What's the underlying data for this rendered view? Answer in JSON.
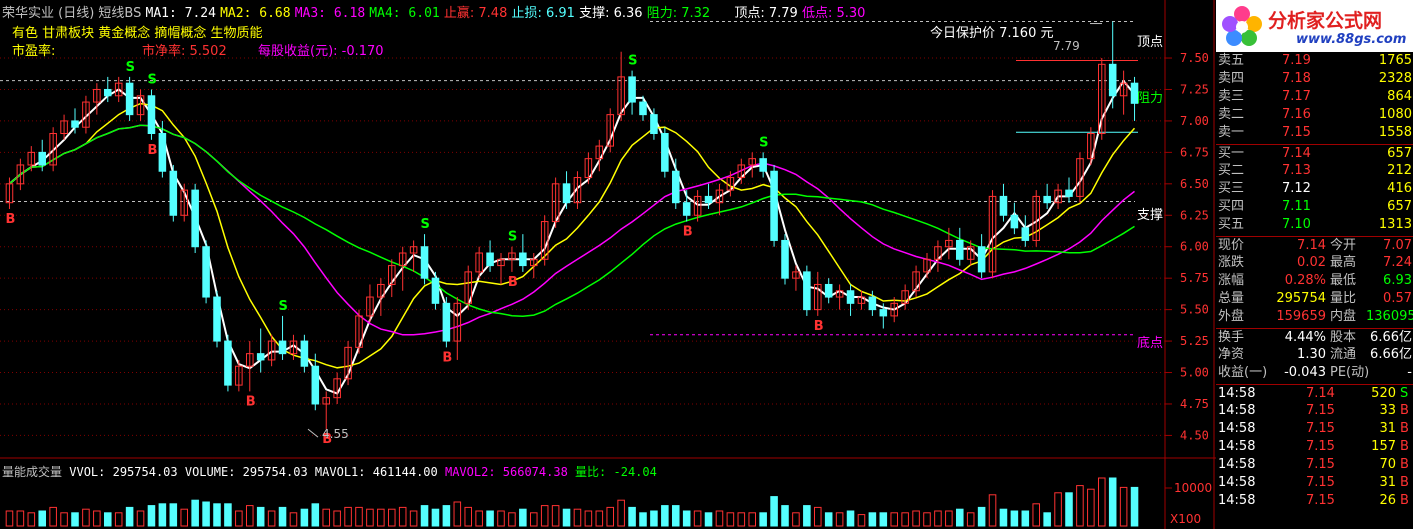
{
  "header": {
    "stock": "荣华实业 (日线)",
    "indicator": "短线BS",
    "ma1": "MA1: 7.24",
    "ma2": "MA2: 6.68",
    "ma3": "MA3: 6.18",
    "ma4": "MA4: 6.01",
    "stop_win": "止赢: 7.48",
    "stop_loss": "止损: 6.91",
    "support": "支撑: 6.36",
    "resistance": "阻力: 7.32",
    "top_point": "顶点: 7.79",
    "low_point": "低点: 5.30",
    "concepts": "有色 甘肃板块 黄金概念 摘帽概念 生物质能",
    "pe_label": "市盈率:",
    "pb": "市净率: 5.502",
    "eps": "每股收益(元): -0.170",
    "protect": "今日保护价 7.160 元"
  },
  "annotations": {
    "top_label": "顶点",
    "resistance_label": "阻力",
    "support_label": "支撑",
    "bottom_label": "底点",
    "high_value": "7.79",
    "low_value": "4.55",
    "buy": "B",
    "sell": "S"
  },
  "volume_header": {
    "title": "量能成交量",
    "vvol": "VVOL: 295754.03",
    "volume": "VOLUME: 295754.03",
    "mavol1": "MAVOL1: 461144.00",
    "mavol2": "MAVOL2: 566074.38",
    "ratio": "量比: -24.04"
  },
  "volume_axis": {
    "top": "10000",
    "unit": "X100"
  },
  "colors": {
    "up": "#ff3232",
    "down": "#54ffff",
    "ma1": "#ffffff",
    "ma2": "#ffff00",
    "ma3": "#ff00ff",
    "ma4": "#00ff00",
    "grid": "#800000",
    "label": "#ff3232"
  },
  "chart_data": {
    "type": "candlestick",
    "y_axis_ticks": [
      "7.50",
      "7.25",
      "7.00",
      "6.75",
      "6.50",
      "6.25",
      "6.00",
      "5.75",
      "5.50",
      "5.25",
      "5.00",
      "4.75",
      "4.50"
    ],
    "ylim": [
      4.4,
      7.85
    ],
    "candles": [
      [
        6.35,
        6.55,
        6.3,
        6.5
      ],
      [
        6.5,
        6.7,
        6.45,
        6.65
      ],
      [
        6.65,
        6.8,
        6.6,
        6.75
      ],
      [
        6.75,
        6.85,
        6.6,
        6.65
      ],
      [
        6.65,
        6.95,
        6.6,
        6.9
      ],
      [
        6.9,
        7.05,
        6.85,
        7.0
      ],
      [
        7.0,
        7.1,
        6.9,
        6.95
      ],
      [
        6.95,
        7.2,
        6.9,
        7.15
      ],
      [
        7.15,
        7.3,
        7.05,
        7.25
      ],
      [
        7.25,
        7.35,
        7.15,
        7.2
      ],
      [
        7.2,
        7.35,
        7.15,
        7.3
      ],
      [
        7.3,
        7.35,
        7.0,
        7.05
      ],
      [
        7.05,
        7.25,
        7.0,
        7.2
      ],
      [
        7.2,
        7.25,
        6.85,
        6.9
      ],
      [
        6.9,
        7.0,
        6.55,
        6.6
      ],
      [
        6.6,
        6.65,
        6.2,
        6.25
      ],
      [
        6.25,
        6.5,
        6.2,
        6.45
      ],
      [
        6.45,
        6.5,
        5.95,
        6.0
      ],
      [
        6.0,
        6.05,
        5.55,
        5.6
      ],
      [
        5.6,
        5.65,
        5.2,
        5.25
      ],
      [
        5.25,
        5.3,
        4.85,
        4.9
      ],
      [
        4.9,
        5.1,
        4.85,
        5.05
      ],
      [
        5.05,
        5.25,
        4.85,
        5.15
      ],
      [
        5.15,
        5.35,
        5.0,
        5.1
      ],
      [
        5.1,
        5.3,
        5.05,
        5.25
      ],
      [
        5.25,
        5.45,
        5.1,
        5.15
      ],
      [
        5.15,
        5.3,
        5.1,
        5.25
      ],
      [
        5.25,
        5.3,
        5.0,
        5.05
      ],
      [
        5.05,
        5.15,
        4.7,
        4.75
      ],
      [
        4.75,
        4.85,
        4.55,
        4.8
      ],
      [
        4.8,
        5.0,
        4.75,
        4.95
      ],
      [
        4.95,
        5.25,
        4.9,
        5.2
      ],
      [
        5.2,
        5.5,
        5.15,
        5.45
      ],
      [
        5.45,
        5.7,
        5.4,
        5.6
      ],
      [
        5.6,
        5.75,
        5.45,
        5.7
      ],
      [
        5.7,
        5.9,
        5.6,
        5.85
      ],
      [
        5.85,
        6.0,
        5.65,
        5.95
      ],
      [
        5.95,
        6.05,
        5.8,
        6.0
      ],
      [
        6.0,
        6.1,
        5.7,
        5.75
      ],
      [
        5.75,
        5.8,
        5.5,
        5.55
      ],
      [
        5.55,
        5.6,
        5.2,
        5.25
      ],
      [
        5.25,
        5.6,
        5.1,
        5.55
      ],
      [
        5.55,
        5.85,
        5.5,
        5.8
      ],
      [
        5.8,
        6.0,
        5.75,
        5.95
      ],
      [
        5.95,
        6.05,
        5.8,
        5.85
      ],
      [
        5.85,
        5.95,
        5.7,
        5.9
      ],
      [
        5.9,
        6.0,
        5.8,
        5.95
      ],
      [
        5.95,
        6.1,
        5.8,
        5.85
      ],
      [
        5.85,
        5.95,
        5.75,
        5.9
      ],
      [
        5.9,
        6.25,
        5.85,
        6.2
      ],
      [
        6.2,
        6.55,
        6.15,
        6.5
      ],
      [
        6.5,
        6.6,
        6.3,
        6.35
      ],
      [
        6.35,
        6.6,
        6.3,
        6.55
      ],
      [
        6.55,
        6.75,
        6.5,
        6.7
      ],
      [
        6.7,
        6.85,
        6.6,
        6.8
      ],
      [
        6.8,
        7.1,
        6.75,
        7.05
      ],
      [
        7.05,
        7.55,
        7.0,
        7.35
      ],
      [
        7.35,
        7.4,
        7.05,
        7.15
      ],
      [
        7.15,
        7.2,
        7.0,
        7.05
      ],
      [
        7.05,
        7.1,
        6.85,
        6.9
      ],
      [
        6.9,
        6.95,
        6.55,
        6.6
      ],
      [
        6.6,
        6.7,
        6.3,
        6.35
      ],
      [
        6.35,
        6.45,
        6.2,
        6.25
      ],
      [
        6.25,
        6.45,
        6.2,
        6.4
      ],
      [
        6.4,
        6.5,
        6.3,
        6.35
      ],
      [
        6.35,
        6.5,
        6.25,
        6.45
      ],
      [
        6.45,
        6.6,
        6.4,
        6.55
      ],
      [
        6.55,
        6.7,
        6.5,
        6.65
      ],
      [
        6.65,
        6.75,
        6.55,
        6.7
      ],
      [
        6.7,
        6.75,
        6.55,
        6.6
      ],
      [
        6.6,
        6.65,
        6.0,
        6.05
      ],
      [
        6.05,
        6.1,
        5.7,
        5.75
      ],
      [
        5.75,
        5.85,
        5.65,
        5.8
      ],
      [
        5.8,
        5.85,
        5.45,
        5.5
      ],
      [
        5.5,
        5.8,
        5.45,
        5.7
      ],
      [
        5.7,
        5.75,
        5.55,
        5.6
      ],
      [
        5.6,
        5.7,
        5.5,
        5.65
      ],
      [
        5.65,
        5.7,
        5.45,
        5.55
      ],
      [
        5.55,
        5.65,
        5.5,
        5.6
      ],
      [
        5.6,
        5.65,
        5.45,
        5.5
      ],
      [
        5.5,
        5.55,
        5.35,
        5.45
      ],
      [
        5.45,
        5.6,
        5.4,
        5.55
      ],
      [
        5.55,
        5.7,
        5.5,
        5.65
      ],
      [
        5.65,
        5.85,
        5.6,
        5.8
      ],
      [
        5.8,
        5.95,
        5.75,
        5.9
      ],
      [
        5.9,
        6.05,
        5.8,
        6.0
      ],
      [
        6.0,
        6.15,
        5.9,
        6.05
      ],
      [
        6.05,
        6.15,
        5.85,
        5.9
      ],
      [
        5.9,
        6.05,
        5.85,
        6.0
      ],
      [
        6.0,
        6.1,
        5.75,
        5.8
      ],
      [
        5.8,
        6.45,
        5.75,
        6.4
      ],
      [
        6.4,
        6.5,
        6.2,
        6.25
      ],
      [
        6.25,
        6.35,
        6.1,
        6.15
      ],
      [
        6.15,
        6.25,
        6.0,
        6.05
      ],
      [
        6.05,
        6.45,
        6.0,
        6.4
      ],
      [
        6.4,
        6.5,
        6.3,
        6.35
      ],
      [
        6.35,
        6.5,
        6.3,
        6.45
      ],
      [
        6.45,
        6.55,
        6.35,
        6.4
      ],
      [
        6.4,
        6.75,
        6.35,
        6.7
      ],
      [
        6.7,
        6.95,
        6.65,
        6.9
      ],
      [
        6.9,
        7.5,
        6.85,
        7.45
      ],
      [
        7.45,
        7.79,
        7.1,
        7.2
      ],
      [
        7.2,
        7.4,
        7.05,
        7.3
      ],
      [
        7.3,
        7.35,
        7.0,
        7.14
      ]
    ],
    "signals": [
      {
        "i": 0,
        "type": "B"
      },
      {
        "i": 11,
        "type": "S"
      },
      {
        "i": 13,
        "type": "S"
      },
      {
        "i": 13,
        "type": "B"
      },
      {
        "i": 25,
        "type": "S"
      },
      {
        "i": 22,
        "type": "B"
      },
      {
        "i": 29,
        "type": "B"
      },
      {
        "i": 38,
        "type": "S"
      },
      {
        "i": 40,
        "type": "B"
      },
      {
        "i": 46,
        "type": "S"
      },
      {
        "i": 46,
        "type": "B"
      },
      {
        "i": 57,
        "type": "S"
      },
      {
        "i": 62,
        "type": "B"
      },
      {
        "i": 69,
        "type": "S"
      },
      {
        "i": 74,
        "type": "B"
      }
    ],
    "volume_ylim": [
      0,
      12000
    ]
  },
  "quote_panel": {
    "asks": [
      {
        "label": "卖五",
        "price": "7.19",
        "vol": "1765"
      },
      {
        "label": "卖四",
        "price": "7.18",
        "vol": "2328"
      },
      {
        "label": "卖三",
        "price": "7.17",
        "vol": "864"
      },
      {
        "label": "卖二",
        "price": "7.16",
        "vol": "1080"
      },
      {
        "label": "卖一",
        "price": "7.15",
        "vol": "1558"
      }
    ],
    "bids": [
      {
        "label": "买一",
        "price": "7.14",
        "vol": "657"
      },
      {
        "label": "买二",
        "price": "7.13",
        "vol": "212"
      },
      {
        "label": "买三",
        "price": "7.12",
        "vol": "416"
      },
      {
        "label": "买四",
        "price": "7.11",
        "vol": "657"
      },
      {
        "label": "买五",
        "price": "7.10",
        "vol": "1313"
      }
    ],
    "stats": [
      [
        "现价",
        "7.14",
        "今开",
        "7.07"
      ],
      [
        "涨跌",
        "0.02",
        "最高",
        "7.24"
      ],
      [
        "涨幅",
        "0.28%",
        "最低",
        "6.93"
      ],
      [
        "总量",
        "295754",
        "量比",
        "0.57"
      ],
      [
        "外盘",
        "159659",
        "内盘",
        "136095"
      ]
    ],
    "stats2": [
      [
        "换手",
        "4.44%",
        "股本",
        "6.66亿"
      ],
      [
        "净资",
        "1.30",
        "流通",
        "6.66亿"
      ],
      [
        "收益(一)",
        "-0.043",
        "PE(动)",
        "-"
      ]
    ],
    "ticks": [
      [
        "14:58",
        "7.14",
        "520",
        "S"
      ],
      [
        "14:58",
        "7.15",
        "33",
        "B"
      ],
      [
        "14:58",
        "7.15",
        "31",
        "B"
      ],
      [
        "14:58",
        "7.15",
        "157",
        "B"
      ],
      [
        "14:58",
        "7.15",
        "70",
        "B"
      ],
      [
        "14:58",
        "7.15",
        "31",
        "B"
      ],
      [
        "14:58",
        "7.15",
        "26",
        "B"
      ]
    ]
  },
  "logo": {
    "text": "分析家公式网",
    "url": "www.88gs.com"
  }
}
